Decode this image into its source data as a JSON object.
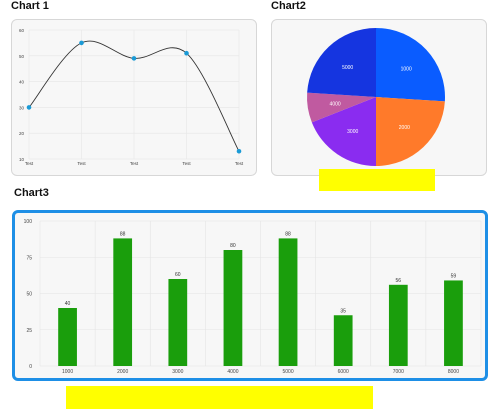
{
  "charts": [
    {
      "title": "Chart 1",
      "chart_data": {
        "type": "line",
        "categories": [
          "Test",
          "Test",
          "Test",
          "Test",
          "Test"
        ],
        "values": [
          30,
          55,
          49,
          51,
          13
        ],
        "ylim": [
          10,
          60
        ],
        "yticks": [
          10,
          20,
          30,
          40,
          50,
          60
        ],
        "grid": true,
        "color": "#1a9ad6"
      }
    },
    {
      "title": "Chart2",
      "chart_data": {
        "type": "pie",
        "slices": [
          {
            "label": "1000",
            "value": 26,
            "color": "#0a5cff"
          },
          {
            "label": "2000",
            "value": 24,
            "color": "#ff7a2a"
          },
          {
            "label": "3000",
            "value": 19,
            "color": "#8a2cf0"
          },
          {
            "label": "4000",
            "value": 7,
            "color": "#c05aa0"
          },
          {
            "label": "5000",
            "value": 24,
            "color": "#1535e0"
          }
        ]
      }
    },
    {
      "title": "Chart3",
      "chart_data": {
        "type": "bar",
        "categories": [
          "1000",
          "2000",
          "3000",
          "4000",
          "5000",
          "6000",
          "7000",
          "8000"
        ],
        "values": [
          40,
          88,
          60,
          80,
          88,
          35,
          56,
          59
        ],
        "ylim": [
          0,
          100
        ],
        "yticks": [
          0,
          25,
          50,
          75,
          100
        ],
        "grid": true,
        "color": "#1a9e0c"
      }
    }
  ],
  "highlight_color": "#ffff00"
}
